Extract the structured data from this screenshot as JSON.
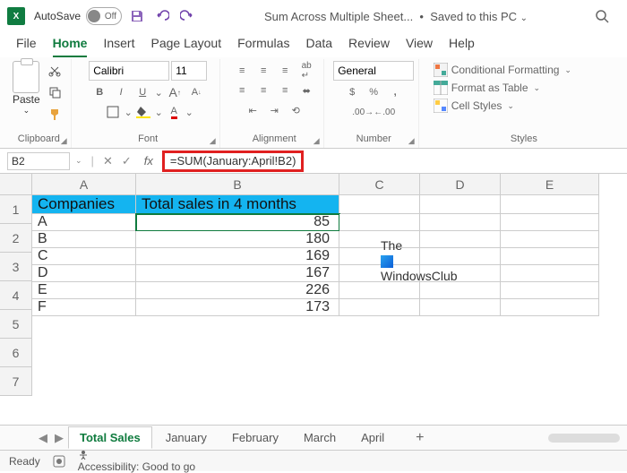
{
  "titlebar": {
    "autosave": "AutoSave",
    "toggle_state": "Off",
    "title": "Sum Across Multiple Sheet...",
    "saved": "Saved to this PC"
  },
  "menu": [
    "File",
    "Home",
    "Insert",
    "Page Layout",
    "Formulas",
    "Data",
    "Review",
    "View",
    "Help"
  ],
  "menu_active": 1,
  "ribbon": {
    "clipboard": {
      "paste": "Paste",
      "label": "Clipboard"
    },
    "font": {
      "name": "Calibri",
      "size": "11",
      "label": "Font"
    },
    "alignment": {
      "label": "Alignment"
    },
    "number": {
      "format": "General",
      "label": "Number"
    },
    "styles": {
      "cond": "Conditional Formatting",
      "table": "Format as Table",
      "cell": "Cell Styles",
      "label": "Styles"
    }
  },
  "formula": {
    "cell": "B2",
    "text": "=SUM(January:April!B2)"
  },
  "cols": [
    "A",
    "B",
    "C",
    "D",
    "E"
  ],
  "rows": [
    "1",
    "2",
    "3",
    "4",
    "5",
    "6",
    "7"
  ],
  "headers": {
    "a": "Companies",
    "b": "Total sales in 4 months"
  },
  "data": [
    {
      "a": "A",
      "b": "85"
    },
    {
      "a": "B",
      "b": "180"
    },
    {
      "a": "C",
      "b": "169"
    },
    {
      "a": "D",
      "b": "167"
    },
    {
      "a": "E",
      "b": "226"
    },
    {
      "a": "F",
      "b": "173"
    }
  ],
  "watermark": {
    "line1": "The",
    "line2": "WindowsClub"
  },
  "sheets": [
    "Total Sales",
    "January",
    "February",
    "March",
    "April"
  ],
  "sheet_active": 0,
  "status": {
    "ready": "Ready",
    "access": "Accessibility: Good to go"
  }
}
